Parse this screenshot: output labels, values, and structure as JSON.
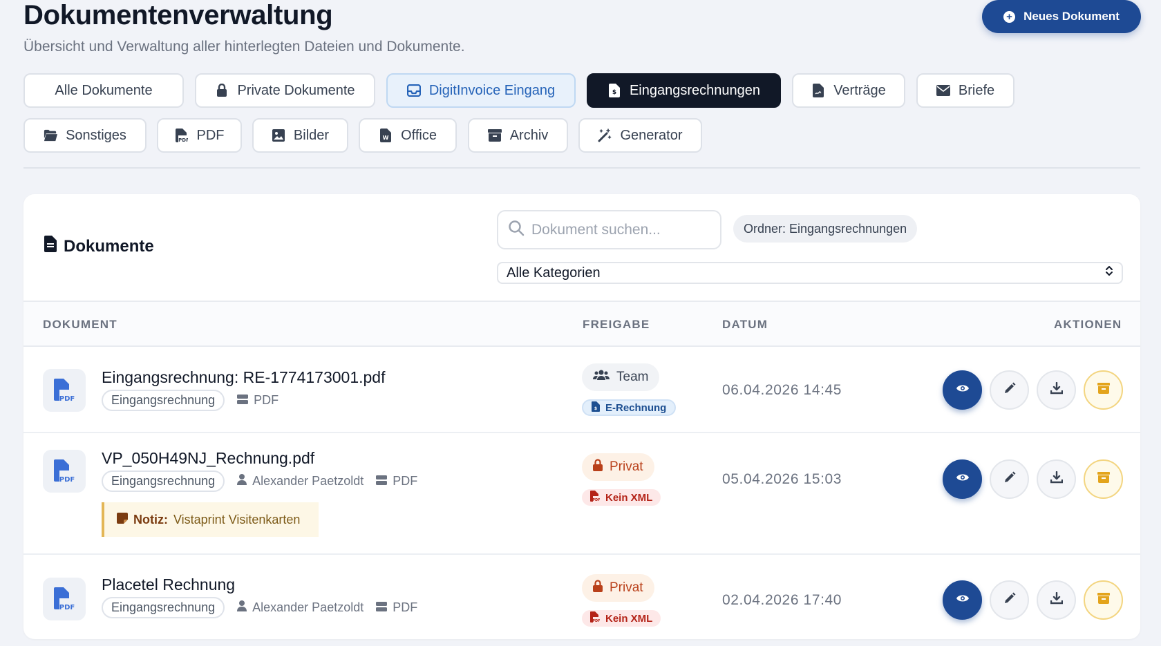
{
  "header": {
    "title": "Dokumentenverwaltung",
    "subtitle": "Übersicht und Verwaltung aller hinterlegten Dateien und Dokumente.",
    "new_button": "Neues Dokument"
  },
  "tabs": [
    {
      "label": "Alle Dokumente",
      "icon": "none"
    },
    {
      "label": "Private Dokumente",
      "icon": "lock-icon"
    },
    {
      "label": "DigitInvoice Eingang",
      "icon": "inbox-icon"
    },
    {
      "label": "Eingangsrechnungen",
      "icon": "invoice-file-icon",
      "active": true
    },
    {
      "label": "Verträge",
      "icon": "contract-icon"
    },
    {
      "label": "Briefe",
      "icon": "envelope-icon"
    },
    {
      "label": "Sonstiges",
      "icon": "folder-open-icon"
    },
    {
      "label": "PDF",
      "icon": "pdf-file-icon"
    },
    {
      "label": "Bilder",
      "icon": "image-icon"
    },
    {
      "label": "Office",
      "icon": "word-file-icon"
    },
    {
      "label": "Archiv",
      "icon": "archive-icon"
    },
    {
      "label": "Generator",
      "icon": "magic-wand-icon"
    }
  ],
  "card": {
    "title": "Dokumente",
    "search_placeholder": "Dokument suchen...",
    "folder_badge": "Ordner: Eingangsrechnungen",
    "category_select": "Alle Kategorien"
  },
  "table": {
    "headers": {
      "document": "DOKUMENT",
      "share": "FREIGABE",
      "date": "DATUM",
      "actions": "AKTIONEN"
    },
    "rows": [
      {
        "name": "Eingangsrechnung: RE-1774173001.pdf",
        "category": "Eingangsrechnung",
        "owner": "",
        "type": "PDF",
        "share": "Team",
        "xml": "E-Rechnung",
        "date": "06.04.2026 14:45",
        "note_label": "",
        "note_text": ""
      },
      {
        "name": "VP_050H49NJ_Rechnung.pdf",
        "category": "Eingangsrechnung",
        "owner": "Alexander Paetzoldt",
        "type": "PDF",
        "share": "Privat",
        "xml": "Kein XML",
        "date": "05.04.2026 15:03",
        "note_label": "Notiz:",
        "note_text": "Vistaprint Visitenkarten"
      },
      {
        "name": "Placetel Rechnung",
        "category": "Eingangsrechnung",
        "owner": "Alexander Paetzoldt",
        "type": "PDF",
        "share": "Privat",
        "xml": "Kein XML",
        "date": "02.04.2026 17:40",
        "note_label": "",
        "note_text": ""
      }
    ]
  },
  "colors": {
    "primary": "#1e4a94",
    "active_tab": "#111827",
    "private": "#b9401a",
    "archive": "#e3a41c"
  }
}
